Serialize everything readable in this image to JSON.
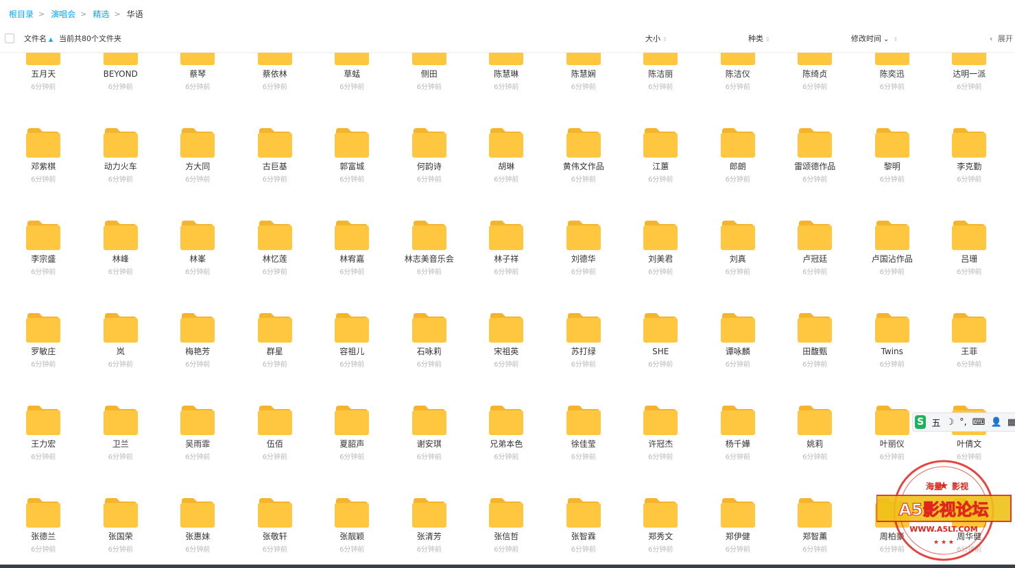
{
  "breadcrumb": {
    "items": [
      "根目录",
      "演唱会",
      "精选"
    ],
    "current": "华语"
  },
  "header": {
    "filename_label": "文件名",
    "count_text": "当前共80个文件夹",
    "size_label": "大小",
    "type_label": "种类",
    "modified_label": "修改时间",
    "expand_label": "展开"
  },
  "folders": [
    {
      "name": "五月天",
      "time": "6分钟前"
    },
    {
      "name": "BEYOND",
      "time": "6分钟前"
    },
    {
      "name": "蔡琴",
      "time": "6分钟前"
    },
    {
      "name": "蔡依林",
      "time": "6分钟前"
    },
    {
      "name": "草蜢",
      "time": "6分钟前"
    },
    {
      "name": "侧田",
      "time": "6分钟前"
    },
    {
      "name": "陈慧琳",
      "time": "6分钟前"
    },
    {
      "name": "陈慧娴",
      "time": "6分钟前"
    },
    {
      "name": "陈洁丽",
      "time": "6分钟前"
    },
    {
      "name": "陈洁仪",
      "time": "6分钟前"
    },
    {
      "name": "陈绮贞",
      "time": "6分钟前"
    },
    {
      "name": "陈奕迅",
      "time": "6分钟前"
    },
    {
      "name": "达明一派",
      "time": "6分钟前"
    },
    {
      "name": "邓紫棋",
      "time": "6分钟前"
    },
    {
      "name": "动力火车",
      "time": "6分钟前"
    },
    {
      "name": "方大同",
      "time": "6分钟前"
    },
    {
      "name": "古巨基",
      "time": "6分钟前"
    },
    {
      "name": "郭富城",
      "time": "6分钟前"
    },
    {
      "name": "何韵诗",
      "time": "6分钟前"
    },
    {
      "name": "胡琳",
      "time": "6分钟前"
    },
    {
      "name": "黄伟文作品",
      "time": "6分钟前"
    },
    {
      "name": "江蕙",
      "time": "6分钟前"
    },
    {
      "name": "郎朗",
      "time": "6分钟前"
    },
    {
      "name": "雷颂德作品",
      "time": "6分钟前"
    },
    {
      "name": "黎明",
      "time": "6分钟前"
    },
    {
      "name": "李克勤",
      "time": "6分钟前"
    },
    {
      "name": "李宗盛",
      "time": "6分钟前"
    },
    {
      "name": "林峰",
      "time": "6分钟前"
    },
    {
      "name": "林峯",
      "time": "6分钟前"
    },
    {
      "name": "林忆莲",
      "time": "6分钟前"
    },
    {
      "name": "林宥嘉",
      "time": "6分钟前"
    },
    {
      "name": "林志美音乐会",
      "time": "6分钟前"
    },
    {
      "name": "林子祥",
      "time": "6分钟前"
    },
    {
      "name": "刘德华",
      "time": "6分钟前"
    },
    {
      "name": "刘美君",
      "time": "6分钟前"
    },
    {
      "name": "刘真",
      "time": "6分钟前"
    },
    {
      "name": "卢冠廷",
      "time": "6分钟前"
    },
    {
      "name": "卢国沾作品",
      "time": "6分钟前"
    },
    {
      "name": "吕珊",
      "time": "6分钟前"
    },
    {
      "name": "罗敏庄",
      "time": "6分钟前"
    },
    {
      "name": "岚",
      "time": "6分钟前"
    },
    {
      "name": "梅艳芳",
      "time": "6分钟前"
    },
    {
      "name": "群星",
      "time": "6分钟前"
    },
    {
      "name": "容祖儿",
      "time": "6分钟前"
    },
    {
      "name": "石咏莉",
      "time": "6分钟前"
    },
    {
      "name": "宋祖英",
      "time": "6分钟前"
    },
    {
      "name": "苏打绿",
      "time": "6分钟前"
    },
    {
      "name": "SHE",
      "time": "6分钟前"
    },
    {
      "name": "谭咏麟",
      "time": "6分钟前"
    },
    {
      "name": "田馥甄",
      "time": "6分钟前"
    },
    {
      "name": "Twins",
      "time": "6分钟前"
    },
    {
      "name": "王菲",
      "time": "6分钟前"
    },
    {
      "name": "王力宏",
      "time": "6分钟前"
    },
    {
      "name": "卫兰",
      "time": "6分钟前"
    },
    {
      "name": "吴雨霏",
      "time": "6分钟前"
    },
    {
      "name": "伍佰",
      "time": "6分钟前"
    },
    {
      "name": "夏韶声",
      "time": "6分钟前"
    },
    {
      "name": "谢安琪",
      "time": "6分钟前"
    },
    {
      "name": "兄弟本色",
      "time": "6分钟前"
    },
    {
      "name": "徐佳莹",
      "time": "6分钟前"
    },
    {
      "name": "许冠杰",
      "time": "6分钟前"
    },
    {
      "name": "杨千嬅",
      "time": "6分钟前"
    },
    {
      "name": "姚莉",
      "time": "6分钟前"
    },
    {
      "name": "叶丽仪",
      "time": "6分钟前"
    },
    {
      "name": "叶倩文",
      "time": "6分钟前"
    },
    {
      "name": "张德兰",
      "time": "6分钟前"
    },
    {
      "name": "张国荣",
      "time": "6分钟前"
    },
    {
      "name": "张惠妹",
      "time": "6分钟前"
    },
    {
      "name": "张敬轩",
      "time": "6分钟前"
    },
    {
      "name": "张靓颖",
      "time": "6分钟前"
    },
    {
      "name": "张清芳",
      "time": "6分钟前"
    },
    {
      "name": "张信哲",
      "time": "6分钟前"
    },
    {
      "name": "张智霖",
      "time": "6分钟前"
    },
    {
      "name": "郑秀文",
      "time": "6分钟前"
    },
    {
      "name": "郑伊健",
      "time": "6分钟前"
    },
    {
      "name": "郑智薰",
      "time": "6分钟前"
    },
    {
      "name": "周柏豪",
      "time": "6分钟前"
    },
    {
      "name": "周华健",
      "time": "6分钟前"
    }
  ],
  "ime_toolbar": {
    "mode": "五",
    "logo": "S"
  },
  "watermark": {
    "top_left": "海量",
    "top_right": "影视",
    "main": "A5影视论坛",
    "url": "WWW.A5LT.COM"
  },
  "colors": {
    "accent": "#06a7ff",
    "folder": "#ffc63f",
    "folder_tab": "#f5b42c",
    "stamp": "#e0251c"
  }
}
